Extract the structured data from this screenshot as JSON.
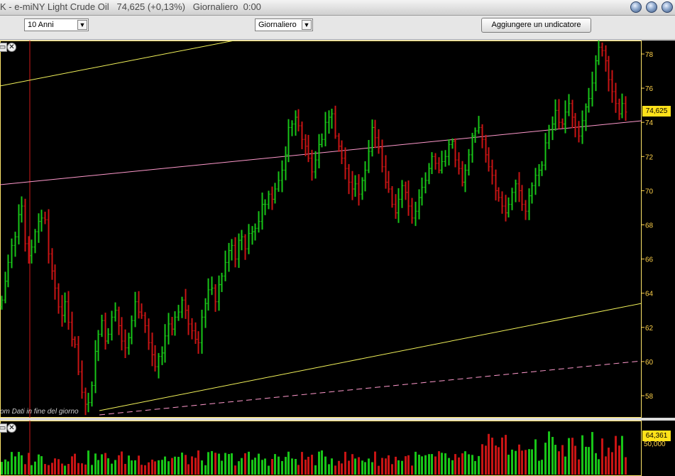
{
  "window": {
    "title": "K - e-miNY Light Crude Oil   74,625 (+0,13%)   Giornaliero  0:00"
  },
  "toolbar": {
    "period_value": "10 Anni",
    "interval_value": "Giornaliero",
    "add_indicator_label": "Aggiungere un undicatore",
    "close_glyph": "✕",
    "restore_glyph": "▭"
  },
  "chart": {
    "source_note": "om  Dati in fine del giorno",
    "last_price_label": "74,625",
    "volume_label": "64,361",
    "volume_tick_label": "50,000",
    "y_tick_labels": [
      "78",
      "76",
      "74",
      "72",
      "70",
      "68",
      "66",
      "64",
      "62",
      "60",
      "58"
    ]
  },
  "colors": {
    "up": "#18c418",
    "down": "#c81414",
    "trend_yellow": "#f2f25a",
    "trend_pink": "#ff99cc",
    "panel_border": "#ffe66a",
    "axis_text": "#ffd24a"
  },
  "chart_data": [
    {
      "type": "candlestick",
      "title": "",
      "ylim": [
        57,
        79
      ],
      "y_ticks": [
        58,
        60,
        62,
        64,
        66,
        68,
        70,
        72,
        74,
        76,
        78
      ],
      "grid": false,
      "last_value": 74.625,
      "seed_open": 63.2,
      "closes": [
        63.6,
        64.7,
        65.8,
        66.8,
        67.3,
        68.6,
        69.1,
        66.9,
        66.2,
        66.7,
        67.6,
        68.2,
        68.4,
        68.3,
        66.3,
        65.3,
        64.3,
        63.2,
        62.7,
        63.5,
        62.3,
        61.3,
        61.0,
        59.4,
        58.2,
        57.5,
        57.6,
        58.6,
        60.6,
        61.6,
        62.4,
        61.2,
        61.6,
        62.6,
        63.0,
        62.1,
        61.2,
        60.8,
        61.4,
        62.4,
        63.5,
        62.9,
        62.7,
        62.1,
        61.1,
        60.4,
        59.7,
        60.3,
        60.5,
        61.5,
        62.2,
        61.9,
        62.6,
        62.9,
        63.6,
        63.0,
        62.2,
        61.8,
        61.3,
        61.1,
        62.6,
        63.4,
        64.2,
        64.3,
        63.5,
        64.5,
        65.0,
        65.8,
        66.5,
        66.8,
        66.0,
        67.1,
        67.3,
        66.6,
        67.5,
        67.6,
        67.8,
        68.2,
        69.2,
        69.2,
        69.8,
        69.5,
        70.1,
        70.6,
        71.2,
        72.1,
        73.7,
        73.9,
        74.3,
        73.8,
        73.0,
        72.6,
        71.9,
        71.1,
        71.8,
        72.7,
        73.0,
        74.0,
        74.3,
        74.5,
        73.2,
        72.6,
        71.9,
        71.3,
        70.5,
        70.1,
        70.4,
        69.8,
        70.6,
        71.2,
        72.3,
        73.7,
        73.1,
        72.5,
        71.4,
        70.5,
        70.1,
        69.2,
        68.7,
        69.5,
        70.3,
        69.9,
        69.1,
        68.4,
        68.8,
        69.6,
        70.2,
        70.6,
        71.3,
        72.0,
        71.6,
        71.2,
        71.7,
        72.0,
        72.7,
        72.9,
        71.8,
        71.3,
        70.5,
        71.2,
        72.1,
        73.2,
        73.5,
        73.7,
        73.0,
        72.1,
        71.4,
        70.9,
        70.0,
        69.6,
        69.1,
        68.7,
        69.2,
        69.9,
        70.4,
        70.0,
        69.2,
        68.8,
        69.7,
        70.3,
        70.9,
        71.2,
        71.5,
        72.8,
        73.6,
        73.9,
        74.7,
        74.0,
        73.9,
        74.6,
        75.1,
        74.3,
        73.7,
        73.2,
        74.1,
        74.9,
        75.4,
        76.3,
        77.6,
        78.4,
        78.2,
        77.6,
        76.5,
        75.8,
        75.1,
        74.5,
        75.1,
        74.6
      ]
    },
    {
      "type": "bar",
      "title": "Volume",
      "y_ticks": [
        50000
      ],
      "ylim": [
        0,
        70000
      ],
      "last_value": 64361
    }
  ]
}
